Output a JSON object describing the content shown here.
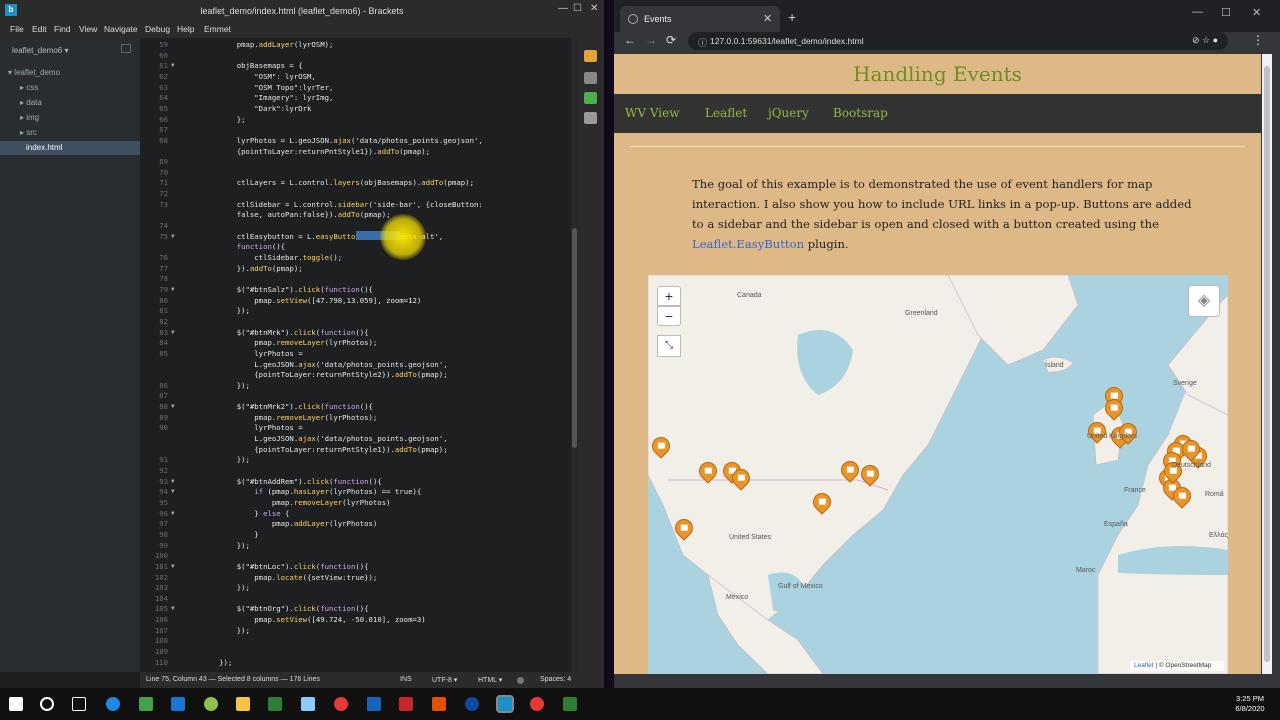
{
  "brackets": {
    "title": "leaflet_demo/index.html (leaflet_demo6) - Brackets",
    "app_icon": "b",
    "menu": [
      "File",
      "Edit",
      "Find",
      "View",
      "Navigate",
      "Debug",
      "Help",
      "Emmet"
    ],
    "project": "leaflet_demo6 ▾",
    "tree": [
      {
        "label": "▾ leaflet_demo",
        "indent": 8,
        "selected": false
      },
      {
        "label": "▸ css",
        "indent": 20,
        "selected": false
      },
      {
        "label": "▸ data",
        "indent": 20,
        "selected": false
      },
      {
        "label": "▸ img",
        "indent": 20,
        "selected": false
      },
      {
        "label": "▸ src",
        "indent": 20,
        "selected": false
      },
      {
        "label": "index.html",
        "indent": 26,
        "selected": true
      }
    ],
    "code": [
      {
        "n": "59",
        "f": "",
        "t": "            pmap.addLayer(lyrOSM);"
      },
      {
        "n": "60",
        "f": "",
        "t": ""
      },
      {
        "n": "61",
        "f": "▼",
        "t": "            objBasemaps = {"
      },
      {
        "n": "62",
        "f": "",
        "t": "                \"OSM\": lyrOSM,"
      },
      {
        "n": "63",
        "f": "",
        "t": "                \"OSM Topo\":lyrTer,"
      },
      {
        "n": "64",
        "f": "",
        "t": "                \"Imagery\": lyrImg,"
      },
      {
        "n": "65",
        "f": "",
        "t": "                \"Dark\":lyrDrk"
      },
      {
        "n": "66",
        "f": "",
        "t": "            };"
      },
      {
        "n": "67",
        "f": "",
        "t": ""
      },
      {
        "n": "68",
        "f": "",
        "t": "            lyrPhotos = L.geoJSON.ajax('data/photos_points.geojson',"
      },
      {
        "n": "",
        "f": "",
        "t": "            {pointToLayer:returnPntStyle1}).addTo(pmap);"
      },
      {
        "n": "69",
        "f": "",
        "t": ""
      },
      {
        "n": "70",
        "f": "",
        "t": ""
      },
      {
        "n": "71",
        "f": "",
        "t": "            ctlLayers = L.control.layers(objBasemaps).addTo(pmap);"
      },
      {
        "n": "72",
        "f": "",
        "t": ""
      },
      {
        "n": "73",
        "f": "",
        "t": "            ctlSidebar = L.control.sidebar('side-bar', {closeButton:"
      },
      {
        "n": "",
        "f": "",
        "t": "            false, autoPan:false}).addTo(pmap);"
      },
      {
        "n": "74",
        "f": "",
        "t": ""
      },
      {
        "n": "75",
        "f": "▼",
        "t": "            ctlEasybutton = L.easyButton('fa-compress-alt',"
      },
      {
        "n": "",
        "f": "",
        "t": "            function(){"
      },
      {
        "n": "76",
        "f": "",
        "t": "                ctlSidebar.toggle();"
      },
      {
        "n": "77",
        "f": "",
        "t": "            }).addTo(pmap);"
      },
      {
        "n": "78",
        "f": "",
        "t": ""
      },
      {
        "n": "79",
        "f": "▼",
        "t": "            $(\"#btnSalz\").click(function(){"
      },
      {
        "n": "80",
        "f": "",
        "t": "                pmap.setView([47.798,13.059], zoom=12)"
      },
      {
        "n": "81",
        "f": "",
        "t": "            });"
      },
      {
        "n": "82",
        "f": "",
        "t": ""
      },
      {
        "n": "83",
        "f": "▼",
        "t": "            $(\"#btnMrk\").click(function(){"
      },
      {
        "n": "84",
        "f": "",
        "t": "                pmap.removeLayer(lyrPhotos);"
      },
      {
        "n": "85",
        "f": "",
        "t": "                lyrPhotos ="
      },
      {
        "n": "",
        "f": "",
        "t": "                L.geoJSON.ajax('data/photos_points.geojson',"
      },
      {
        "n": "",
        "f": "",
        "t": "                {pointToLayer:returnPntStyle2}).addTo(pmap);"
      },
      {
        "n": "86",
        "f": "",
        "t": "            });"
      },
      {
        "n": "87",
        "f": "",
        "t": ""
      },
      {
        "n": "88",
        "f": "▼",
        "t": "            $(\"#btnMrk2\").click(function(){"
      },
      {
        "n": "89",
        "f": "",
        "t": "                pmap.removeLayer(lyrPhotos);"
      },
      {
        "n": "90",
        "f": "",
        "t": "                lyrPhotos ="
      },
      {
        "n": "",
        "f": "",
        "t": "                L.geoJSON.ajax('data/photos_points.geojson',"
      },
      {
        "n": "",
        "f": "",
        "t": "                {pointToLayer:returnPntStyle1}).addTo(pmap);"
      },
      {
        "n": "91",
        "f": "",
        "t": "            });"
      },
      {
        "n": "92",
        "f": "",
        "t": ""
      },
      {
        "n": "93",
        "f": "▼",
        "t": "            $(\"#btnAddRem\").click(function(){"
      },
      {
        "n": "94",
        "f": "▼",
        "t": "                if (pmap.hasLayer(lyrPhotos) == true){"
      },
      {
        "n": "95",
        "f": "",
        "t": "                    pmap.removeLayer(lyrPhotos)"
      },
      {
        "n": "96",
        "f": "▼",
        "t": "                } else {"
      },
      {
        "n": "97",
        "f": "",
        "t": "                    pmap.addLayer(lyrPhotos)"
      },
      {
        "n": "98",
        "f": "",
        "t": "                }"
      },
      {
        "n": "99",
        "f": "",
        "t": "            });"
      },
      {
        "n": "100",
        "f": "",
        "t": ""
      },
      {
        "n": "101",
        "f": "▼",
        "t": "            $(\"#btnLoc\").click(function(){"
      },
      {
        "n": "102",
        "f": "",
        "t": "                pmap.locate({setView:true});"
      },
      {
        "n": "103",
        "f": "",
        "t": "            });"
      },
      {
        "n": "104",
        "f": "",
        "t": ""
      },
      {
        "n": "105",
        "f": "▼",
        "t": "            $(\"#btnOrg\").click(function(){"
      },
      {
        "n": "106",
        "f": "",
        "t": "                pmap.setView([49.724, -50.010], zoom=3)"
      },
      {
        "n": "107",
        "f": "",
        "t": "            });"
      },
      {
        "n": "108",
        "f": "",
        "t": ""
      },
      {
        "n": "109",
        "f": "",
        "t": ""
      },
      {
        "n": "110",
        "f": "",
        "t": "        });"
      }
    ],
    "status": {
      "position": "Line 75, Column 43 — Selected 8 columns — 176 Lines",
      "ins": "INS",
      "encoding": "UTF-8 ▾",
      "language": "HTML ▾",
      "spaces": "Spaces: 4"
    }
  },
  "chrome": {
    "tab_title": "Events",
    "tab_close": "✕",
    "new_tab": "+",
    "url": "127.0.0.1:59631/leaflet_demo/index.html",
    "window_controls": [
      "—",
      "☐",
      "✕"
    ],
    "nav": [
      "←",
      "→",
      "⟳"
    ]
  },
  "page": {
    "title": "Handling Events",
    "nav": [
      "WV View",
      "Leaflet",
      "jQuery",
      "Bootsrap"
    ],
    "intro_before": "The goal of this example is to demonstrated the use of event handlers for map interaction. I also show you how to include URL links in a pop-up. Buttons are added to a sidebar and the sidebar is open and closed with a button created using the ",
    "intro_link": "Leaflet.EasyButton",
    "intro_after": " plugin."
  },
  "map": {
    "zoom_in": "+",
    "zoom_out": "−",
    "labels": [
      {
        "text": "Canada"
      },
      {
        "text": "Greenland"
      },
      {
        "text": "Ísland"
      },
      {
        "text": "Sverige"
      },
      {
        "text": "United Kingdom"
      },
      {
        "text": "Deutschland"
      },
      {
        "text": "France"
      },
      {
        "text": "España"
      },
      {
        "text": "Româ"
      },
      {
        "text": "Ελλάς"
      },
      {
        "text": "United States"
      },
      {
        "text": "México"
      },
      {
        "text": "Gulf of Mexico"
      },
      {
        "text": "Maroc"
      }
    ],
    "attribution_link": "Leaflet",
    "attribution_text": " | © OpenStreetMap"
  },
  "taskbar": {
    "time": "3:25 PM",
    "date": "6/8/2020"
  },
  "colors": {
    "page_bg": "#deb887",
    "accent_green": "#6b8e23",
    "marker_orange": "#e8962c",
    "water": "#aad3df"
  }
}
